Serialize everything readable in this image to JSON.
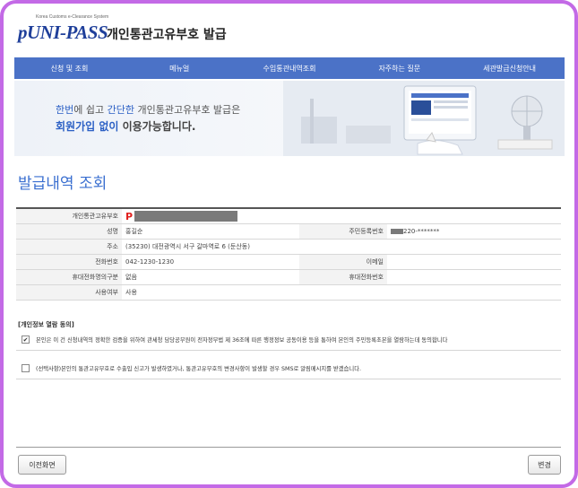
{
  "header": {
    "logo_tagline": "Korea Customs e-Clearance System",
    "logo_text": "pUNI-PASS",
    "title": "개인통관고유부호 발급"
  },
  "nav": {
    "items": [
      "신청 및 조회",
      "메뉴얼",
      "수입통관내역조회",
      "자주하는 질문",
      "세관발급신청안내"
    ]
  },
  "banner": {
    "line1_pre": "한번",
    "line1_mid1": "에 쉽고 ",
    "line1_hl": "간단한",
    "line1_post": " 개인통관고유부호 발급은",
    "line2_hl": "회원가입 없이",
    "line2_post": " 이용가능합니다."
  },
  "page": {
    "title": "발급내역 조회"
  },
  "info": {
    "pcc_label": "개인통관고유부호",
    "pcc_prefix": "P",
    "name_label": "성명",
    "name_value": "홍길순",
    "rrn_label": "주민등록번호",
    "rrn_suffix": "220-*******",
    "address_label": "주소",
    "address_value": "(35230)  대전광역시 서구 갈마역로 6 (둔산동)",
    "phone_label": "전화번호",
    "phone_value": "042-1230-1230",
    "email_label": "이메일",
    "email_value": "",
    "mobile_owner_label": "휴대전화명의구분",
    "mobile_owner_value": "없음",
    "mobile_label": "휴대전화번호",
    "mobile_value": "",
    "use_label": "사용여부",
    "use_value": "사용"
  },
  "agreements": {
    "title": "[개인정보 열람 동의]",
    "consent1_text": "본인은 이 건 신청내역의 정확한 검증을 위하여 관세청 담당공무원이 전자정부법 제 36조에 따른 행정정보 공동이용 등을 통하여 본인의 주민등록초본을 열람하는데 동의합니다",
    "consent1_checked": true,
    "consent2_text": "(선택사항)본인의 통관고유부호로 수출입 신고가 발생하였거나, 통관고유부호의 변경사항이 발생할 경우 SMS로 알림메시지를 받겠습니다.",
    "consent2_checked": false
  },
  "buttons": {
    "back": "이전화면",
    "change": "변경"
  }
}
